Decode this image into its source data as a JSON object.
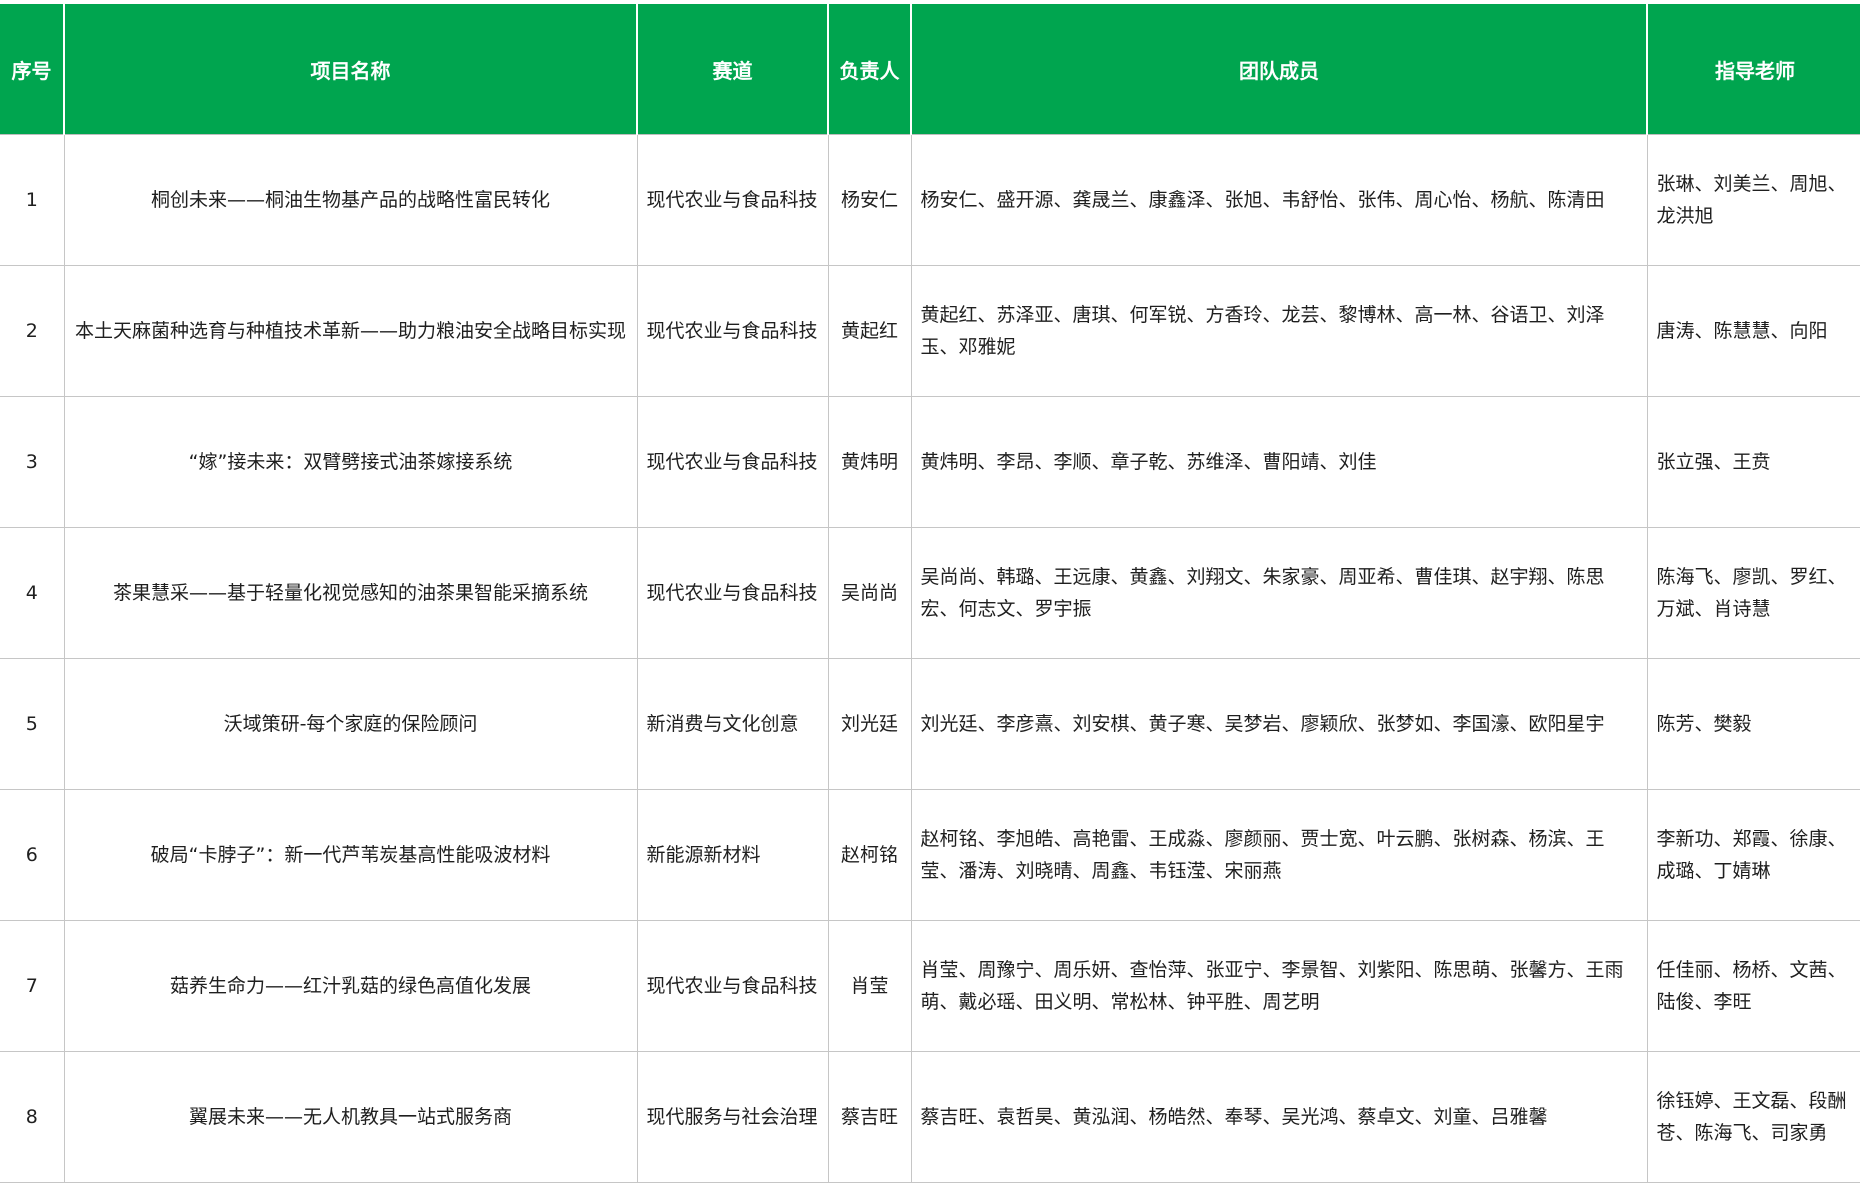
{
  "table": {
    "headers": {
      "seq": "序号",
      "name": "项目名称",
      "track": "赛道",
      "leader": "负责人",
      "team": "团队成员",
      "advisor": "指导老师"
    },
    "rows": [
      {
        "seq": "1",
        "name": "桐创未来——桐油生物基产品的战略性富民转化",
        "track": "现代农业与食品科技",
        "leader": "杨安仁",
        "team": "杨安仁、盛开源、龚晟兰、康鑫泽、张旭、韦舒怡、张伟、周心怡、杨航、陈清田",
        "advisor": "张琳、刘美兰、周旭、龙洪旭"
      },
      {
        "seq": "2",
        "name": "本土天麻菌种选育与种植技术革新——助力粮油安全战略目标实现",
        "track": "现代农业与食品科技",
        "leader": "黄起红",
        "team": "黄起红、苏泽亚、唐琪、何军锐、方香玲、龙芸、黎博林、高一林、谷语卫、刘泽玉、邓雅妮",
        "advisor": "唐涛、陈慧慧、向阳"
      },
      {
        "seq": "3",
        "name": "“嫁”接未来：双臂劈接式油茶嫁接系统",
        "track": "现代农业与食品科技",
        "leader": "黄炜明",
        "team": "黄炜明、李昂、李顺、章子乾、苏维泽、曹阳靖、刘佳",
        "advisor": "张立强、王贲"
      },
      {
        "seq": "4",
        "name": "茶果慧采——基于轻量化视觉感知的油茶果智能采摘系统",
        "track": "现代农业与食品科技",
        "leader": "吴尚尚",
        "team": "吴尚尚、韩璐、王远康、黄鑫、刘翔文、朱家豪、周亚希、曹佳琪、赵宇翔、陈思宏、何志文、罗宇振",
        "advisor": "陈海飞、廖凯、罗红、万斌、肖诗慧"
      },
      {
        "seq": "5",
        "name": "沃域策研-每个家庭的保险顾问",
        "track": "新消费与文化创意",
        "leader": "刘光廷",
        "team": "刘光廷、李彦熹、刘安棋、黄子寒、吴梦岩、廖颖欣、张梦如、李国濠、欧阳星宇",
        "advisor": "陈芳、樊毅"
      },
      {
        "seq": "6",
        "name": "破局“卡脖子”：新一代芦苇炭基高性能吸波材料",
        "track": "新能源新材料",
        "leader": "赵柯铭",
        "team": "赵柯铭、李旭皓、高艳雷、王成淼、廖颜丽、贾士宽、叶云鹏、张树森、杨滨、王莹、潘涛、刘晓晴、周鑫、韦钰滢、宋丽燕",
        "advisor": "李新功、郑霞、徐康、成璐、丁婧琳"
      },
      {
        "seq": "7",
        "name": "菇养生命力——红汁乳菇的绿色高值化发展",
        "track": "现代农业与食品科技",
        "leader": "肖莹",
        "team": "肖莹、周豫宁、周乐妍、查怡萍、张亚宁、李景智、刘紫阳、陈思萌、张馨方、王雨萌、戴必瑶、田义明、常松林、钟平胜、周艺明",
        "advisor": "任佳丽、杨桥、文茜、陆俊、李旺"
      },
      {
        "seq": "8",
        "name": "翼展未来——无人机教具一站式服务商",
        "track": "现代服务与社会治理",
        "leader": "蔡吉旺",
        "team": "蔡吉旺、袁哲昊、黄泓润、杨皓然、奉琴、吴光鸿、蔡卓文、刘童、吕雅馨",
        "advisor": "徐钰婷、王文磊、段酬苍、陈海飞、司家勇"
      }
    ]
  },
  "colors": {
    "header_bg": "#00a54f",
    "header_text": "#ffffff",
    "grid_line": "#c6c6c6"
  }
}
